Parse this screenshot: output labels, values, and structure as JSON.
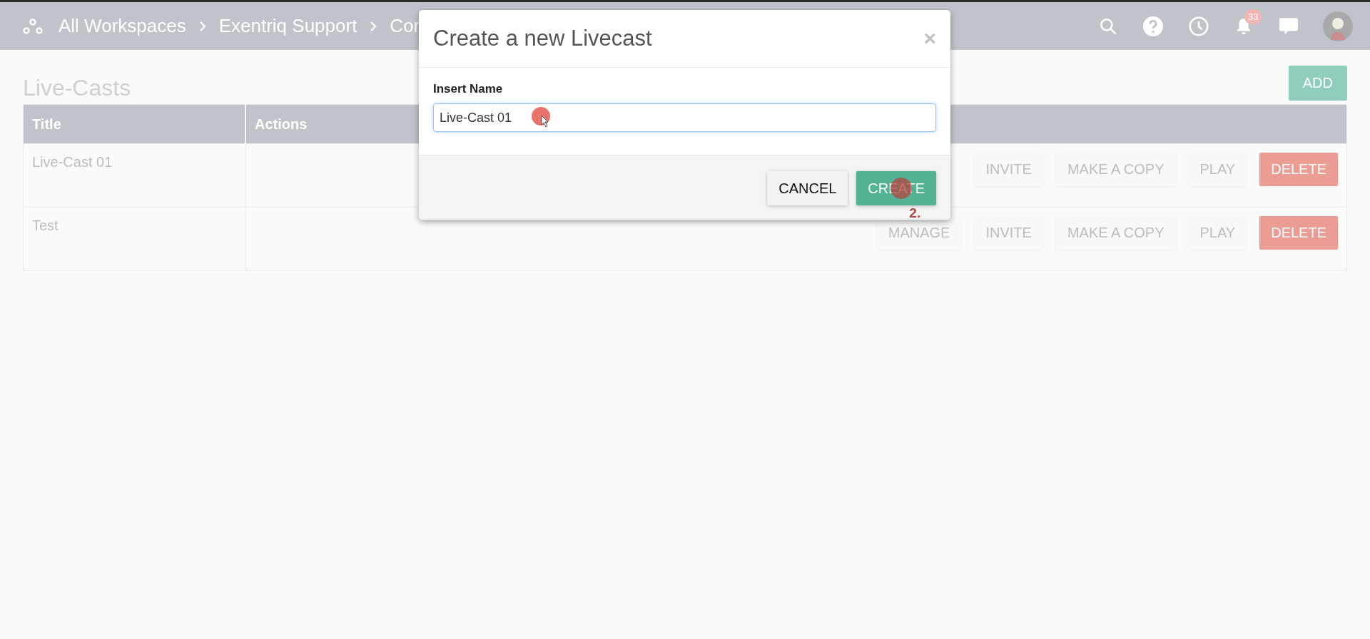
{
  "topbar": {
    "breadcrumb": [
      "All Workspaces",
      "Exentriq Support",
      "Cor"
    ],
    "notifications_badge": "33"
  },
  "page": {
    "title": "Live-Casts",
    "add_button": "ADD"
  },
  "table": {
    "columns": [
      "Title",
      "Actions"
    ],
    "rows": [
      {
        "title": "Live-Cast 01",
        "actions": [
          {
            "label": "INVITE",
            "kind": "normal"
          },
          {
            "label": "MAKE A COPY",
            "kind": "normal"
          },
          {
            "label": "PLAY",
            "kind": "normal"
          },
          {
            "label": "DELETE",
            "kind": "danger"
          }
        ]
      },
      {
        "title": "Test",
        "actions": [
          {
            "label": "MANAGE",
            "kind": "normal"
          },
          {
            "label": "INVITE",
            "kind": "normal"
          },
          {
            "label": "MAKE A COPY",
            "kind": "normal"
          },
          {
            "label": "PLAY",
            "kind": "normal"
          },
          {
            "label": "DELETE",
            "kind": "danger"
          }
        ]
      }
    ]
  },
  "dialog": {
    "title": "Create a new Livecast",
    "close": "×",
    "field_label": "Insert Name",
    "field_value": "Live-Cast 01",
    "buttons": [
      {
        "label": "CANCEL",
        "kind": "secondary"
      },
      {
        "label": "CREATE",
        "kind": "primary"
      }
    ],
    "step_marker": "2."
  }
}
